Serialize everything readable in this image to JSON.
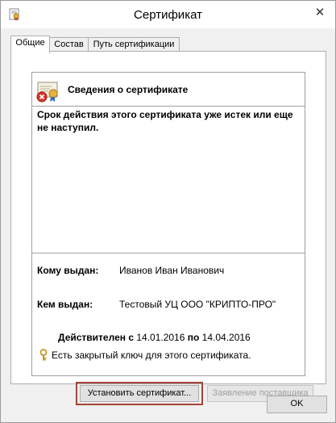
{
  "window": {
    "title": "Сертификат",
    "close_label": "✕"
  },
  "tabs": [
    {
      "label": "Общие"
    },
    {
      "label": "Состав"
    },
    {
      "label": "Путь сертификации"
    }
  ],
  "info": {
    "heading": "Сведения о сертификате",
    "warning": "Срок действия этого сертификата уже истек или еще не наступил.",
    "issued_to_label": "Кому выдан:",
    "issued_to_value": "Иванов Иван Иванович",
    "issued_by_label": "Кем выдан:",
    "issued_by_value": "Тестовый УЦ ООО \"КРИПТО-ПРО\"",
    "valid_from_label": "Действителен с",
    "valid_from": "14.01.2016",
    "valid_to_label": "по",
    "valid_to": "14.04.2016",
    "private_key_note": "Есть закрытый ключ для этого сертификата."
  },
  "buttons": {
    "install": "Установить сертификат...",
    "issuer_statement": "Заявление поставщика",
    "ok": "OK"
  },
  "colors": {
    "highlight": "#a5443a"
  }
}
